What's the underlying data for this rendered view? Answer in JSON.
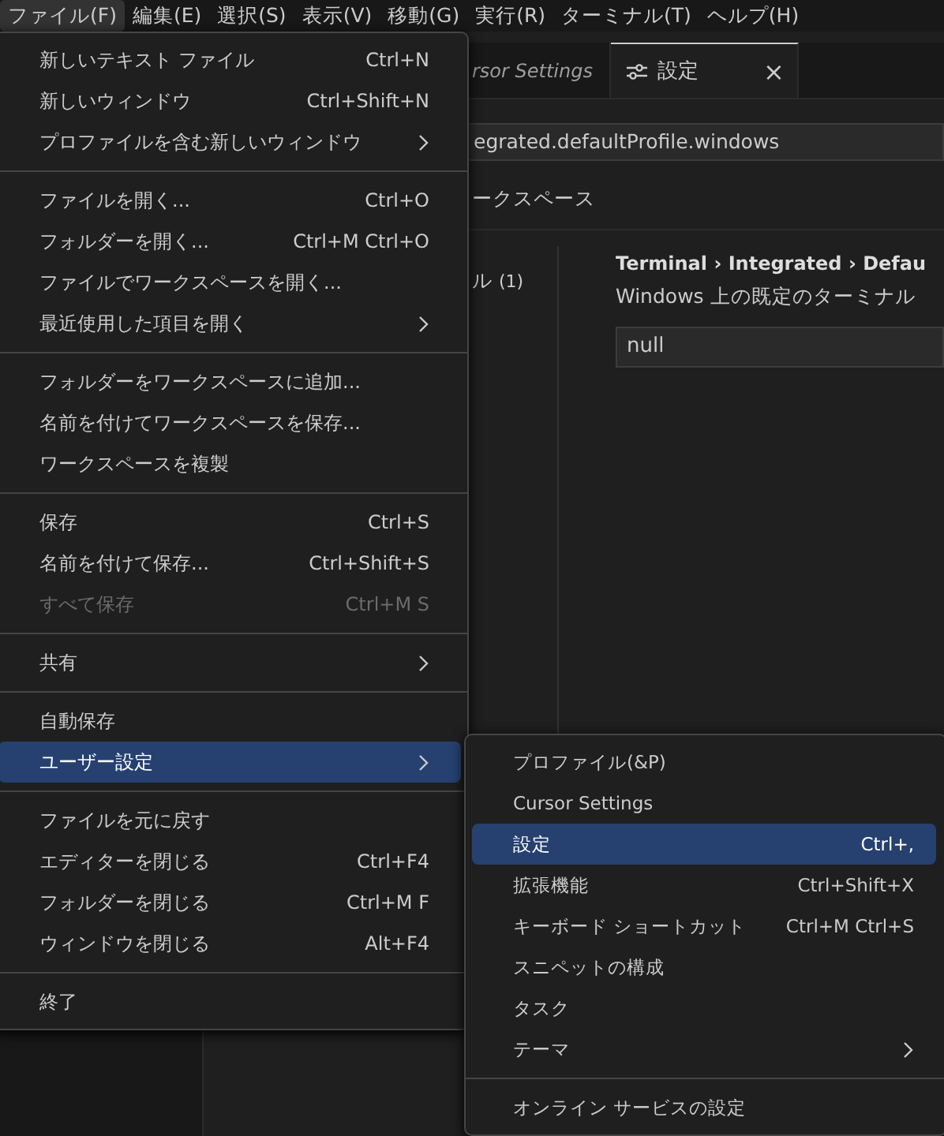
{
  "menubar": [
    {
      "label": "ファイル(F)",
      "selected": true
    },
    {
      "label": "編集(E)",
      "selected": false
    },
    {
      "label": "選択(S)",
      "selected": false
    },
    {
      "label": "表示(V)",
      "selected": false
    },
    {
      "label": "移動(G)",
      "selected": false
    },
    {
      "label": "実行(R)",
      "selected": false
    },
    {
      "label": "ターミナル(T)",
      "selected": false
    },
    {
      "label": "ヘルプ(H)",
      "selected": false
    }
  ],
  "editor": {
    "tabs": [
      {
        "label": "rsor Settings",
        "selected": false,
        "italic": true,
        "closable": false
      },
      {
        "label": "設定",
        "selected": true,
        "italic": false,
        "closable": true,
        "close": "×"
      }
    ],
    "search": {
      "value": "egrated.defaultProfile.windows"
    },
    "scope_tab": "ークスペース",
    "tree_item": {
      "label": "ル",
      "count": "(1)"
    },
    "setting": {
      "title": "Terminal › Integrated › Defau",
      "description": "Windows 上の既定のターミナル",
      "value": "null"
    }
  },
  "file_menu": [
    [
      {
        "label": "新しいテキスト ファイル",
        "shortcut": "Ctrl+N",
        "submenu": false,
        "disabled": false,
        "selected": false
      },
      {
        "label": "新しいウィンドウ",
        "shortcut": "Ctrl+Shift+N",
        "submenu": false,
        "disabled": false,
        "selected": false
      },
      {
        "label": "プロファイルを含む新しいウィンドウ",
        "submenu": true,
        "disabled": false,
        "selected": false
      }
    ],
    [
      {
        "label": "ファイルを開く...",
        "shortcut": "Ctrl+O",
        "submenu": false,
        "disabled": false,
        "selected": false
      },
      {
        "label": "フォルダーを開く...",
        "shortcut": "Ctrl+M Ctrl+O",
        "submenu": false,
        "disabled": false,
        "selected": false
      },
      {
        "label": "ファイルでワークスペースを開く...",
        "submenu": false,
        "disabled": false,
        "selected": false
      },
      {
        "label": "最近使用した項目を開く",
        "submenu": true,
        "disabled": false,
        "selected": false
      }
    ],
    [
      {
        "label": "フォルダーをワークスペースに追加...",
        "submenu": false,
        "disabled": false,
        "selected": false
      },
      {
        "label": "名前を付けてワークスペースを保存...",
        "submenu": false,
        "disabled": false,
        "selected": false
      },
      {
        "label": "ワークスペースを複製",
        "submenu": false,
        "disabled": false,
        "selected": false
      }
    ],
    [
      {
        "label": "保存",
        "shortcut": "Ctrl+S",
        "submenu": false,
        "disabled": false,
        "selected": false
      },
      {
        "label": "名前を付けて保存...",
        "shortcut": "Ctrl+Shift+S",
        "submenu": false,
        "disabled": false,
        "selected": false
      },
      {
        "label": "すべて保存",
        "shortcut": "Ctrl+M S",
        "submenu": false,
        "disabled": true,
        "selected": false
      }
    ],
    [
      {
        "label": "共有",
        "submenu": true,
        "disabled": false,
        "selected": false
      }
    ],
    [
      {
        "label": "自動保存",
        "submenu": false,
        "disabled": false,
        "selected": false
      },
      {
        "label": "ユーザー設定",
        "submenu": true,
        "disabled": false,
        "selected": true
      }
    ],
    [
      {
        "label": "ファイルを元に戻す",
        "submenu": false,
        "disabled": false,
        "selected": false
      },
      {
        "label": "エディターを閉じる",
        "shortcut": "Ctrl+F4",
        "submenu": false,
        "disabled": false,
        "selected": false
      },
      {
        "label": "フォルダーを閉じる",
        "shortcut": "Ctrl+M F",
        "submenu": false,
        "disabled": false,
        "selected": false
      },
      {
        "label": "ウィンドウを閉じる",
        "shortcut": "Alt+F4",
        "submenu": false,
        "disabled": false,
        "selected": false
      }
    ],
    [
      {
        "label": "終了",
        "submenu": false,
        "disabled": false,
        "selected": false
      }
    ]
  ],
  "user_settings_menu": [
    [
      {
        "label": "プロファイル(&P)",
        "submenu": false,
        "disabled": false,
        "selected": false
      },
      {
        "label": "Cursor Settings",
        "submenu": false,
        "disabled": false,
        "selected": false
      },
      {
        "label": "設定",
        "shortcut": "Ctrl+,",
        "submenu": false,
        "disabled": false,
        "selected": true
      },
      {
        "label": "拡張機能",
        "shortcut": "Ctrl+Shift+X",
        "submenu": false,
        "disabled": false,
        "selected": false
      },
      {
        "label": "キーボード ショートカット",
        "shortcut": "Ctrl+M Ctrl+S",
        "submenu": false,
        "disabled": false,
        "selected": false
      },
      {
        "label": "スニペットの構成",
        "submenu": false,
        "disabled": false,
        "selected": false
      },
      {
        "label": "タスク",
        "submenu": false,
        "disabled": false,
        "selected": false
      },
      {
        "label": "テーマ",
        "submenu": true,
        "disabled": false,
        "selected": false
      }
    ],
    [
      {
        "label": "オンライン サービスの設定",
        "submenu": false,
        "disabled": false,
        "selected": false
      }
    ]
  ]
}
